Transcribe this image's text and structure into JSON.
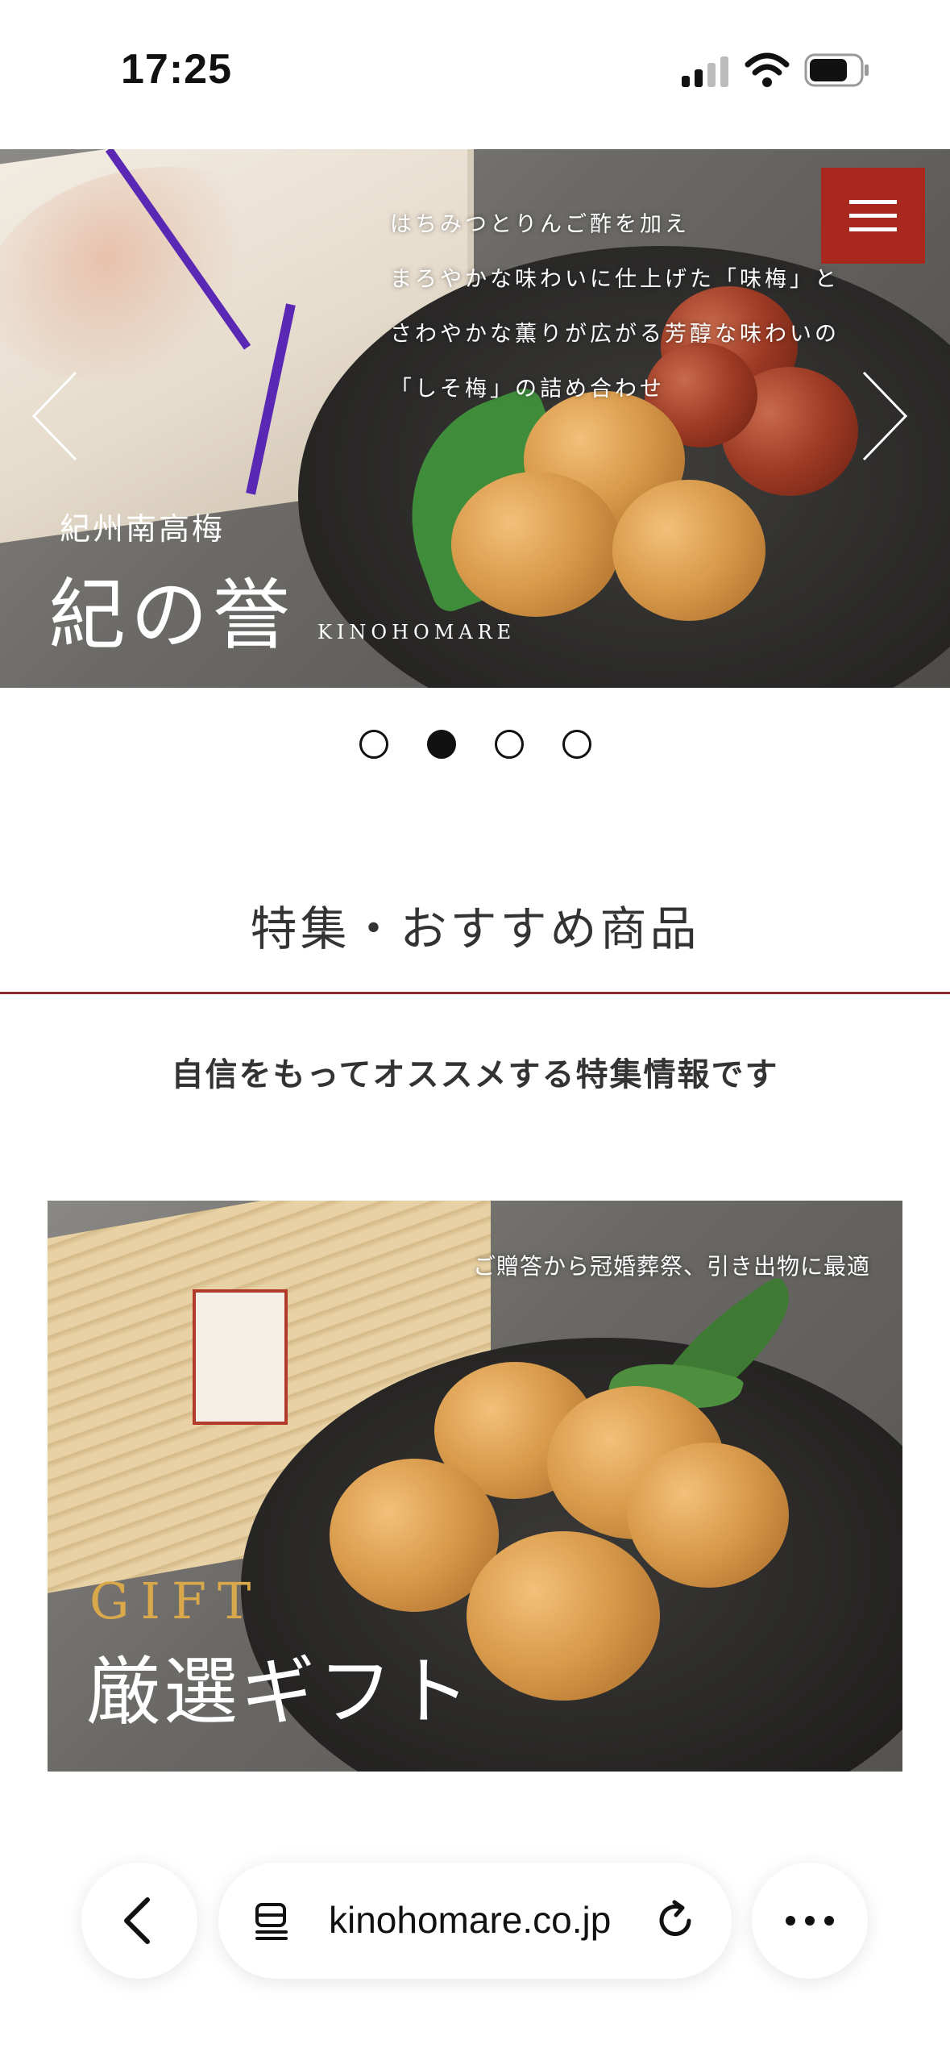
{
  "status_bar": {
    "time": "17:25"
  },
  "hero": {
    "lines": [
      "はちみつとりんご酢を加え",
      "まろやかな味わいに仕上げた「味梅」と",
      "さわやかな薫りが広がる芳醇な味わいの",
      "「しそ梅」の詰め合わせ"
    ],
    "subtitle": "紀州南高梅",
    "title": "紀の誉",
    "roman": "KINOHOMARE",
    "active_slide": 2,
    "slide_count": 4
  },
  "section": {
    "title": "特集・おすすめ商品",
    "subtitle": "自信をもってオススメする特集情報です"
  },
  "gift": {
    "caption": "ご贈答から冠婚葬祭、引き出物に最適",
    "english": "GIFT",
    "japanese": "厳選ギフト"
  },
  "browser": {
    "url": "kinohomare.co.jp"
  },
  "colors": {
    "accent_red": "#a8281e",
    "divider": "#8d2a2a",
    "gift_gold": "#d9a84a"
  }
}
